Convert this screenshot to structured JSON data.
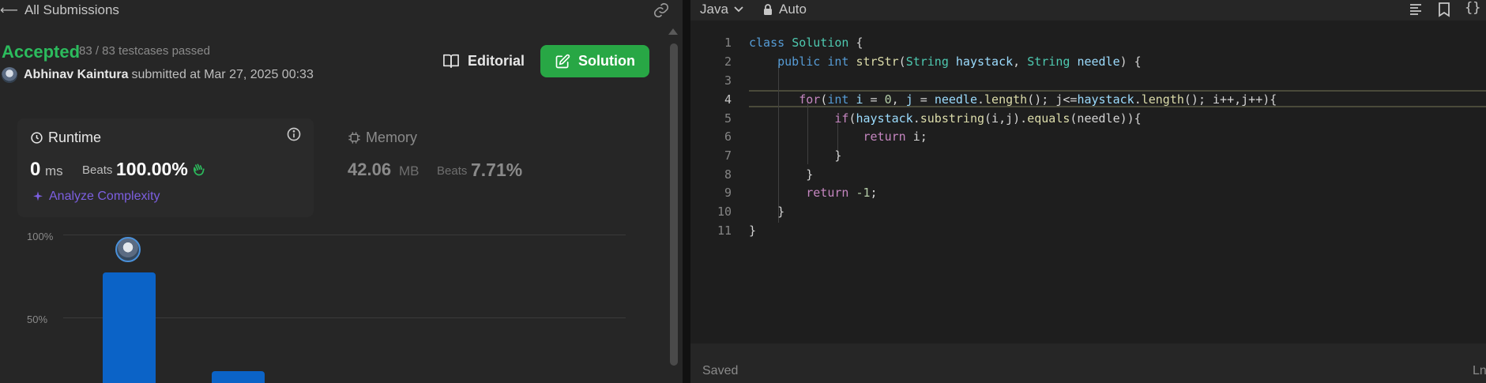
{
  "header": {
    "back_label": "All Submissions"
  },
  "result": {
    "status": "Accepted",
    "testcases": "83 / 83 testcases passed",
    "user": "Abhinav Kaintura",
    "submitted_text": "submitted at Mar 27, 2025 00:33"
  },
  "buttons": {
    "editorial": "Editorial",
    "solution": "Solution"
  },
  "runtime": {
    "title": "Runtime",
    "value": "0",
    "unit": "ms",
    "beats_label": "Beats",
    "beats_value": "100.00%",
    "analyze": "Analyze Complexity"
  },
  "memory": {
    "title": "Memory",
    "value": "42.06",
    "unit": "MB",
    "beats_label": "Beats",
    "beats_value": "7.71%"
  },
  "chart": {
    "y_100": "100%",
    "y_50": "50%"
  },
  "editor": {
    "language": "Java",
    "mode": "Auto",
    "status": "Saved",
    "status_right": "Ln",
    "line_numbers": [
      "1",
      "2",
      "3",
      "4",
      "5",
      "6",
      "7",
      "8",
      "9",
      "10",
      "11"
    ],
    "active_line": 4
  },
  "colors": {
    "accepted": "#2cbb5d",
    "solution_button": "#28a745",
    "bar": "#0b63c7",
    "analyze": "#7c5fe0"
  }
}
